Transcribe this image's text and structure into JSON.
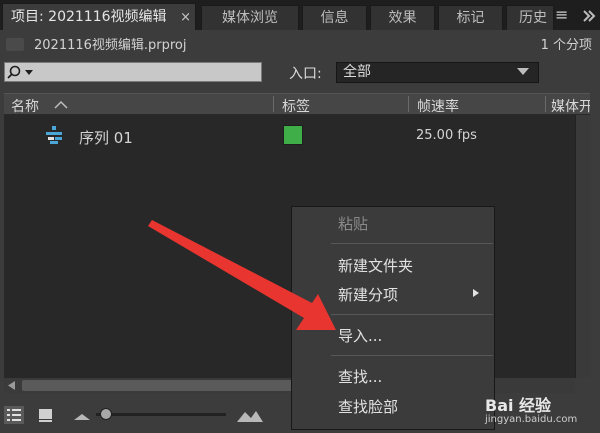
{
  "tabs": [
    {
      "label": "项目: 2021116视频编辑",
      "active": true
    },
    {
      "label": "媒体浏览"
    },
    {
      "label": "信息"
    },
    {
      "label": "效果"
    },
    {
      "label": "标记"
    },
    {
      "label": "历史"
    }
  ],
  "tab_close": "×",
  "project": {
    "name": "2021116视频编辑.prproj",
    "count": "1 个分项"
  },
  "search": {
    "icon": "search-icon",
    "value": ""
  },
  "entry": {
    "label": "入口:",
    "selected": "全部"
  },
  "columns": [
    "名称",
    "标签",
    "帧速率",
    "媒体开"
  ],
  "rows": [
    {
      "name": "序列 01",
      "label_color": "#3fae49",
      "fps": "25.00 fps"
    }
  ],
  "context_menu": {
    "items": [
      "粘贴",
      "新建文件夹",
      "新建分项",
      "导入...",
      "查找...",
      "查找脸部"
    ],
    "disabled": [
      "粘贴"
    ]
  },
  "watermark": {
    "brand": "Bai 经验",
    "url": "jingyan.baidu.com"
  },
  "colors": {
    "accent_arrow": "#e8352f",
    "label_green": "#3fae49"
  }
}
